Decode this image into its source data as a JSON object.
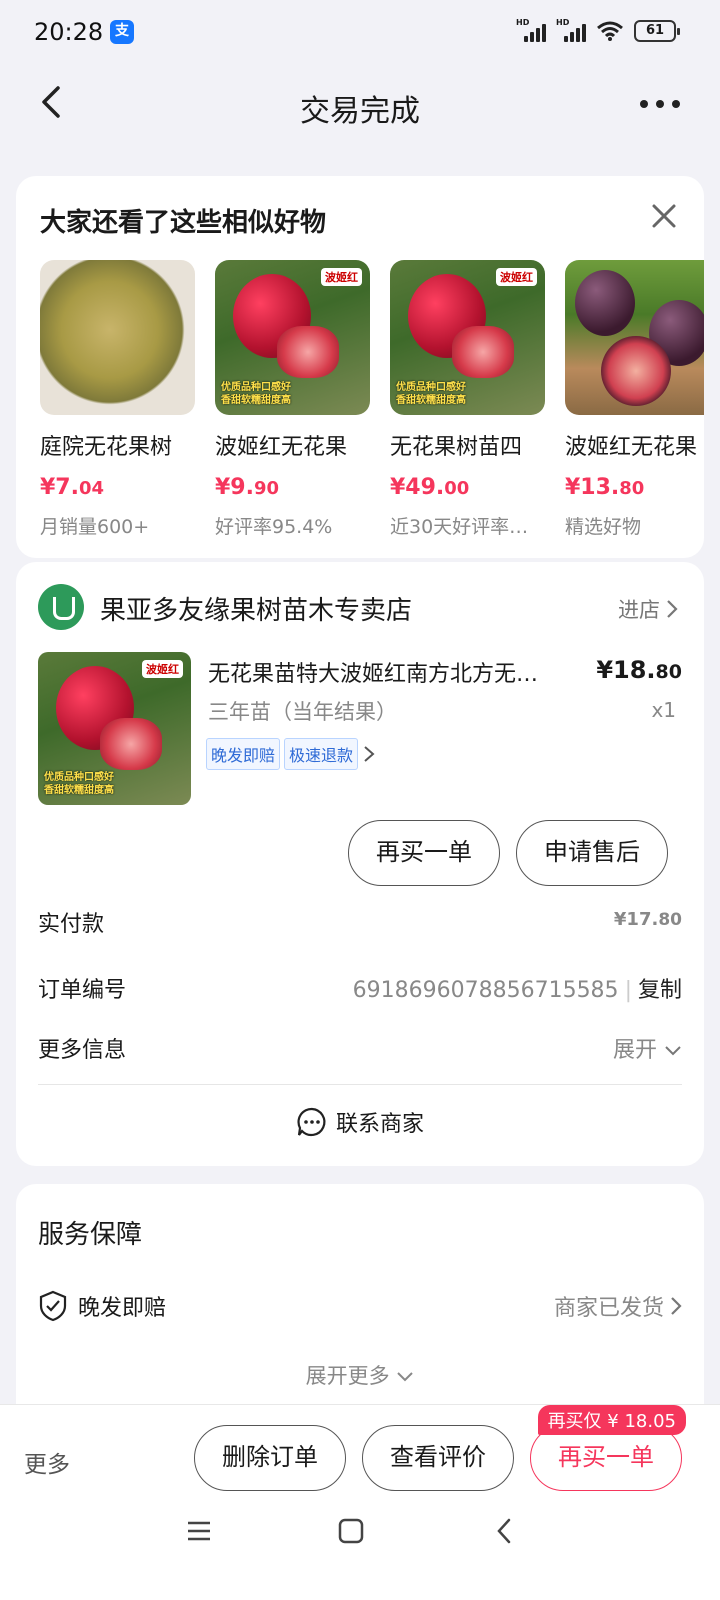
{
  "status": {
    "time": "20:28",
    "battery": "61",
    "net1": "HD",
    "net2": "HD"
  },
  "nav": {
    "title": "交易完成"
  },
  "recommend": {
    "heading": "大家还看了这些相似好物",
    "items": [
      {
        "name": "庭院无花果树",
        "price_main": "¥7.",
        "price_small": "04",
        "sub": "月销量600+"
      },
      {
        "name": "波姬红无花果",
        "price_main": "¥9.",
        "price_small": "90",
        "sub": "好评率95.4%"
      },
      {
        "name": "无花果树苗四",
        "price_main": "¥49.",
        "price_small": "00",
        "sub": "近30天好评率…"
      },
      {
        "name": "波姬红无花果",
        "price_main": "¥13.",
        "price_small": "80",
        "sub": "精选好物"
      }
    ],
    "img_labels": {
      "top": "波姬红",
      "bottom1": "优质品种口感好",
      "bottom2": "香甜软糯甜度高"
    }
  },
  "order": {
    "shop_name": "果亚多友缘果树苗木专卖店",
    "enter_shop": "进店",
    "product_title": "无花果苗特大波姬红南方北方无…",
    "price_main": "¥18.",
    "price_small": "80",
    "spec": "三年苗（当年结果）",
    "qty": "x1",
    "tags": [
      "晚发即赔",
      "极速退款"
    ],
    "buy_again": "再买一单",
    "after_sale": "申请售后",
    "paid_label": "实付款",
    "paid_main": "¥17.",
    "paid_small": "80",
    "order_no_label": "订单编号",
    "order_no": "6918696078856715585",
    "copy": "复制",
    "more_info_label": "更多信息",
    "expand": "展开",
    "contact": "联系商家"
  },
  "service": {
    "heading": "服务保障",
    "item_label": "晚发即赔",
    "item_status": "商家已发货",
    "expand_more": "展开更多"
  },
  "bottom": {
    "more": "更多",
    "delete": "删除订单",
    "review": "查看评价",
    "buy_again": "再买一单",
    "promo": "再买仅 ¥ 18.05"
  },
  "colors": {
    "accent": "#f5365c",
    "tag_blue": "#2f6bd6",
    "shop_green": "#2d9a5a"
  }
}
